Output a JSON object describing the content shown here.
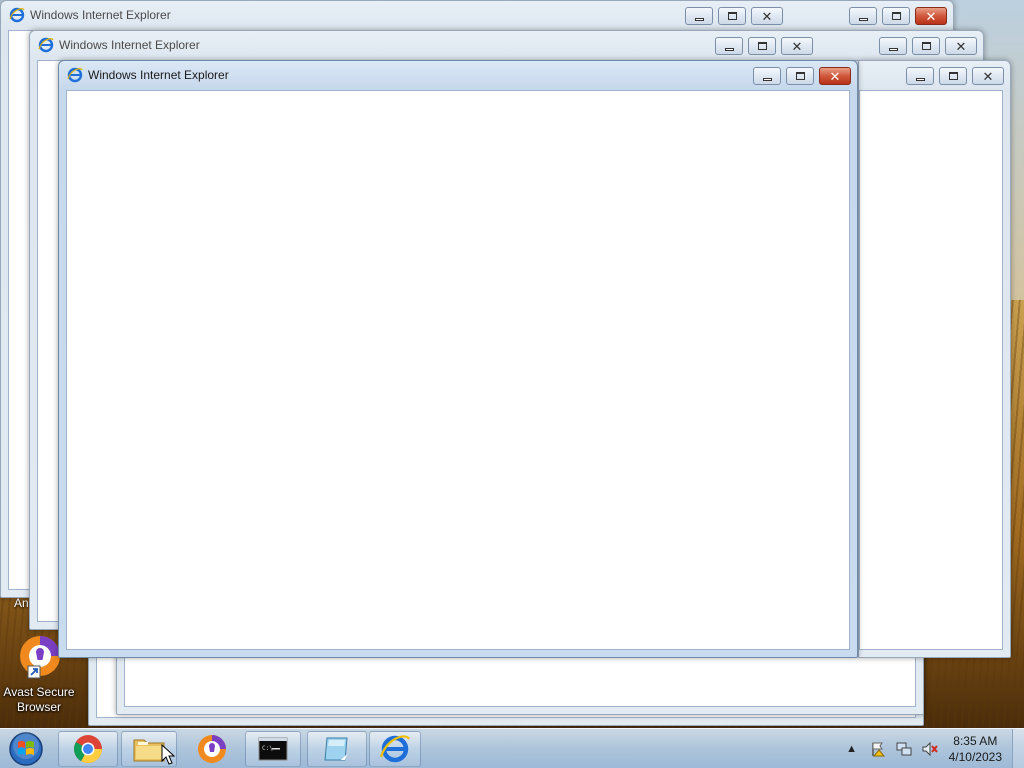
{
  "windows": [
    {
      "title": "Windows Internet Explorer"
    },
    {
      "title": "Windows Internet Explorer"
    },
    {
      "title": "Windows Internet Explorer"
    },
    {
      "title": "Windows Internet Explorer"
    }
  ],
  "desktop": {
    "partial_label": "An",
    "icon_label_line1": "Avast Secure",
    "icon_label_line2": "Browser"
  },
  "taskbar": {
    "pinned": [
      "chrome-icon",
      "file-explorer-icon",
      "avast-secure-browser-icon",
      "command-prompt-icon",
      "notepad-icon",
      "internet-explorer-icon"
    ],
    "clock_time": "8:35 AM",
    "clock_date": "4/10/2023",
    "tray_icons": [
      "show-hidden-icons-chevron",
      "action-center-flag-icon",
      "network-icon",
      "volume-muted-icon"
    ]
  },
  "colors": {
    "accent": "#1e6fd9",
    "close_active": "#c9452a",
    "titlebar": "#c6d8ec"
  }
}
